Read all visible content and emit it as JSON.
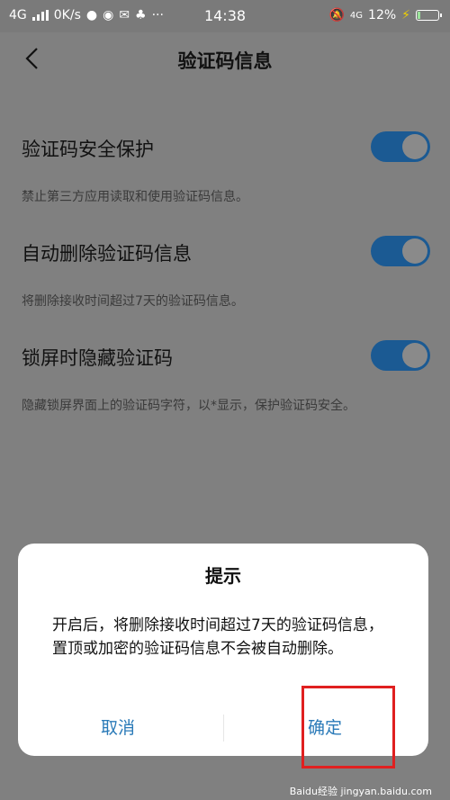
{
  "status_bar": {
    "network": "4G",
    "speed": "0K/s",
    "more": "···",
    "time": "14:38",
    "right_network": "4G",
    "battery_percent": "12%",
    "battery_level": 0.12
  },
  "header": {
    "title": "验证码信息"
  },
  "settings": [
    {
      "label": "验证码安全保护",
      "enabled": true,
      "desc": "禁止第三方应用读取和使用验证码信息。"
    },
    {
      "label": "自动删除验证码信息",
      "enabled": true,
      "desc": "将删除接收时间超过7天的验证码信息。"
    },
    {
      "label": "锁屏时隐藏验证码",
      "enabled": true,
      "desc": "隐藏锁屏界面上的验证码字符，以*显示，保护验证码安全。"
    }
  ],
  "dialog": {
    "title": "提示",
    "message": "开启后，将删除接收时间超过7天的验证码信息，置顶或加密的验证码信息不会被自动删除。",
    "cancel_label": "取消",
    "ok_label": "确定"
  },
  "watermark": "Baidu经验 jingyan.baidu.com",
  "colors": {
    "accent": "#2a7ab8",
    "toggle_on": "#1b5a93",
    "highlight": "#e02020"
  },
  "icons": [
    "signal-icon",
    "wechat-icon",
    "weibo-icon",
    "mail-icon",
    "qq-icon",
    "mute-icon",
    "charging-icon",
    "back-icon"
  ]
}
